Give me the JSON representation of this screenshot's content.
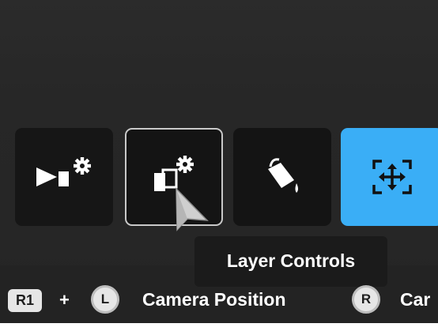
{
  "colors": {
    "background": "#262626",
    "tile": "#161616",
    "selected_border": "#c9c9c9",
    "accent": "#3aaef6",
    "text": "#ffffff"
  },
  "toolbar": {
    "tools": [
      {
        "icon": "camera-settings-icon",
        "selected": false,
        "active": false
      },
      {
        "icon": "layer-settings-icon",
        "selected": true,
        "active": false
      },
      {
        "icon": "paint-bucket-icon",
        "selected": false,
        "active": false
      },
      {
        "icon": "move-arrows-icon",
        "selected": false,
        "active": true
      }
    ]
  },
  "tooltip": {
    "text": "Layer Controls"
  },
  "hint_bar": {
    "button_label": "R1",
    "plus": "+",
    "left_stick_letter": "L",
    "left_action": "Camera Position",
    "right_stick_letter": "R",
    "right_action": "Car"
  }
}
